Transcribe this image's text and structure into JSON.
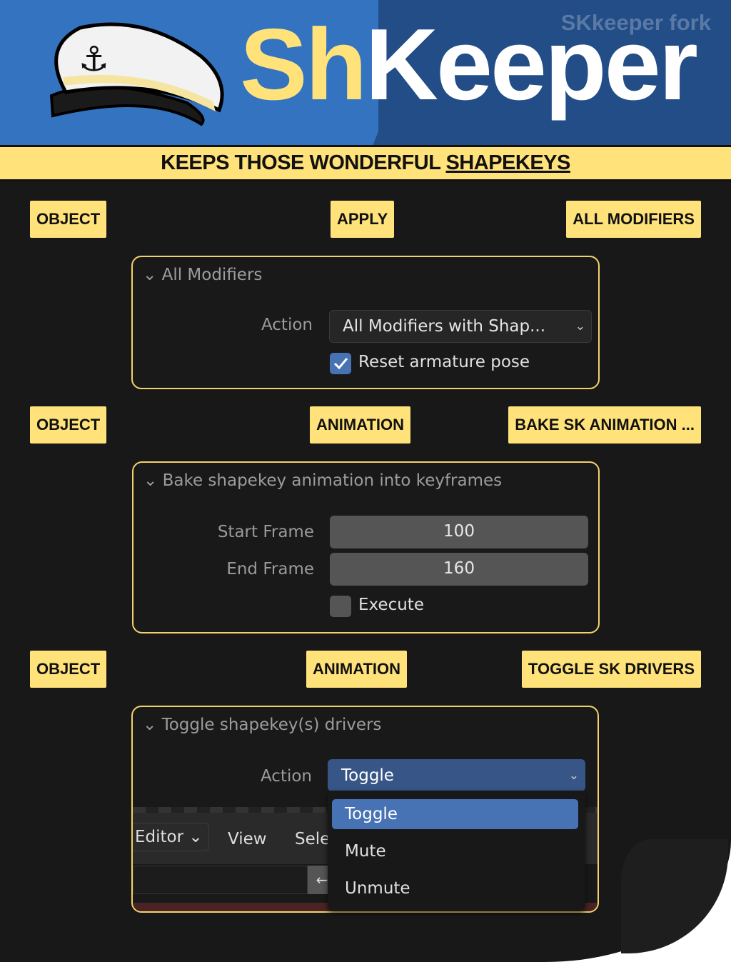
{
  "header": {
    "fork_label": "SKkeeper fork",
    "logo_part1": "Sh",
    "logo_part2": "Keeper",
    "tagline_prefix": "KEEPS THOSE WONDERFUL ",
    "tagline_emph": "SHAPEKEYS"
  },
  "sections": [
    {
      "tags": [
        "OBJECT",
        "APPLY",
        "ALL MODIFIERS"
      ],
      "panel": {
        "title": "All Modifiers",
        "action_label": "Action",
        "action_value": "All Modifiers with Shap...",
        "checkbox_label": "Reset armature pose",
        "checkbox_checked": true
      }
    },
    {
      "tags": [
        "OBJECT",
        "ANIMATION",
        "BAKE SK ANIMATION ..."
      ],
      "panel": {
        "title": "Bake shapekey animation into keyframes",
        "start_label": "Start Frame",
        "start_value": "100",
        "end_label": "End Frame",
        "end_value": "160",
        "checkbox_label": "Execute",
        "checkbox_checked": false
      }
    },
    {
      "tags": [
        "OBJECT",
        "ANIMATION",
        "TOGGLE SK DRIVERS"
      ],
      "panel": {
        "title": "Toggle shapekey(s) drivers",
        "action_label": "Action",
        "action_value": "Toggle",
        "options": [
          "Toggle",
          "Mute",
          "Unmute"
        ],
        "bg_menu": [
          "Editor",
          "View",
          "Sele"
        ]
      }
    }
  ],
  "colors": {
    "accent": "#ffe27a",
    "blue": "#3473c0",
    "select": "#4772b3"
  }
}
